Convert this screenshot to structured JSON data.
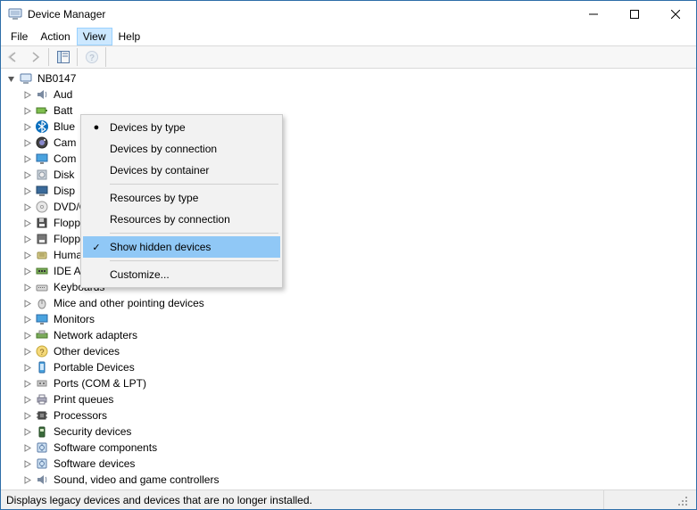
{
  "window": {
    "title": "Device Manager"
  },
  "menubar": {
    "items": [
      {
        "label": "File"
      },
      {
        "label": "Action"
      },
      {
        "label": "View"
      },
      {
        "label": "Help"
      }
    ],
    "open_index": 2
  },
  "dropdown": {
    "groups": [
      {
        "label": "Devices by type",
        "mark": "dot"
      },
      {
        "label": "Devices by connection",
        "mark": ""
      },
      {
        "label": "Devices by container",
        "mark": ""
      }
    ],
    "resources": [
      {
        "label": "Resources by type",
        "mark": ""
      },
      {
        "label": "Resources by connection",
        "mark": ""
      }
    ],
    "show_hidden": {
      "label": "Show hidden devices",
      "mark": "check",
      "highlight": true
    },
    "customize": {
      "label": "Customize...",
      "mark": ""
    }
  },
  "tree": {
    "root": {
      "label": "NB0147",
      "icon": "computer",
      "expanded": true
    },
    "children": [
      {
        "label": "Aud",
        "full_label": "Audio inputs and outputs",
        "icon": "sound"
      },
      {
        "label": "Batt",
        "full_label": "Batteries",
        "icon": "battery"
      },
      {
        "label": "Blue",
        "full_label": "Bluetooth",
        "icon": "bluetooth"
      },
      {
        "label": "Cam",
        "full_label": "Cameras",
        "icon": "camera"
      },
      {
        "label": "Com",
        "full_label": "Computer",
        "icon": "monitor"
      },
      {
        "label": "Disk",
        "full_label": "Disk drives",
        "icon": "disk"
      },
      {
        "label": "Disp",
        "full_label": "Display adapters",
        "icon": "display"
      },
      {
        "label": "DVD/CD-ROM drives",
        "full_label": "DVD/CD-ROM drives",
        "icon": "dvd"
      },
      {
        "label": "Floppy disk drives",
        "full_label": "Floppy disk drives",
        "icon": "floppy"
      },
      {
        "label": "Floppy drive controllers",
        "full_label": "Floppy drive controllers",
        "icon": "floppyctl"
      },
      {
        "label": "Human Interface Devices",
        "full_label": "Human Interface Devices",
        "icon": "hid"
      },
      {
        "label": "IDE ATA/ATAPI controllers",
        "full_label": "IDE ATA/ATAPI controllers",
        "icon": "ide"
      },
      {
        "label": "Keyboards",
        "full_label": "Keyboards",
        "icon": "keyboard"
      },
      {
        "label": "Mice and other pointing devices",
        "full_label": "Mice and other pointing devices",
        "icon": "mouse"
      },
      {
        "label": "Monitors",
        "full_label": "Monitors",
        "icon": "monitor"
      },
      {
        "label": "Network adapters",
        "full_label": "Network adapters",
        "icon": "network"
      },
      {
        "label": "Other devices",
        "full_label": "Other devices",
        "icon": "other"
      },
      {
        "label": "Portable Devices",
        "full_label": "Portable Devices",
        "icon": "portable"
      },
      {
        "label": "Ports (COM & LPT)",
        "full_label": "Ports (COM & LPT)",
        "icon": "port"
      },
      {
        "label": "Print queues",
        "full_label": "Print queues",
        "icon": "printer"
      },
      {
        "label": "Processors",
        "full_label": "Processors",
        "icon": "cpu"
      },
      {
        "label": "Security devices",
        "full_label": "Security devices",
        "icon": "security"
      },
      {
        "label": "Software components",
        "full_label": "Software components",
        "icon": "software"
      },
      {
        "label": "Software devices",
        "full_label": "Software devices",
        "icon": "software"
      },
      {
        "label": "Sound, video and game controllers",
        "full_label": "Sound, video and game controllers",
        "icon": "sound"
      }
    ],
    "truncated_count": 7
  },
  "statusbar": {
    "text": "Displays legacy devices and devices that are no longer installed."
  },
  "colors": {
    "highlight_bg": "#90c8f6",
    "menu_open_bg": "#cce8ff"
  }
}
